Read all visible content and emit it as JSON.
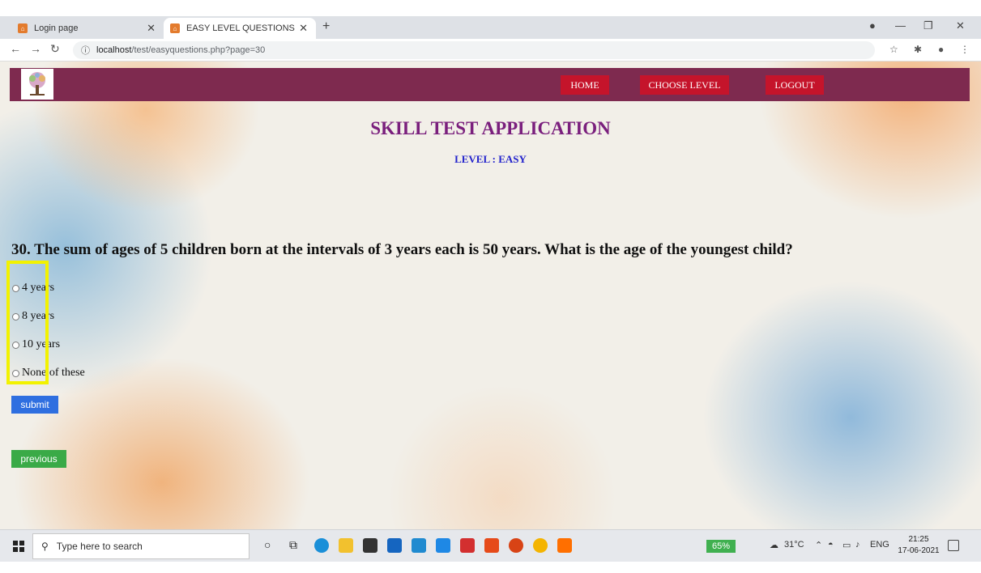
{
  "browser": {
    "tabs": [
      {
        "title": "Login page"
      },
      {
        "title": "EASY LEVEL QUESTIONS"
      }
    ],
    "url_host": "localhost",
    "url_path": "/test/easyquestions.php?page=30"
  },
  "navbar": {
    "links": [
      "HOME",
      "CHOOSE LEVEL",
      "LOGOUT"
    ]
  },
  "app": {
    "title": "SKILL TEST APPLICATION",
    "level": "LEVEL : EASY"
  },
  "quiz": {
    "question": "30. The sum of ages of 5 children born at the intervals of 3 years each is 50 years. What is the age of the youngest child?",
    "options": [
      "4 years",
      "8 years",
      "10 years",
      "None of these"
    ],
    "submit_label": "submit",
    "previous_label": "previous"
  },
  "taskbar": {
    "search_placeholder": "Type here to search",
    "battery": "65%",
    "weather": "31°C",
    "language": "ENG",
    "time": "21:25",
    "date": "17-06-2021"
  },
  "colors": {
    "navbar": "#7e2a4f",
    "nav_button": "#c5142b",
    "title": "#7a1f7d",
    "level": "#2323cc",
    "submit": "#2f6fe0",
    "previous": "#3aaa47",
    "highlight": "#f2f200"
  }
}
